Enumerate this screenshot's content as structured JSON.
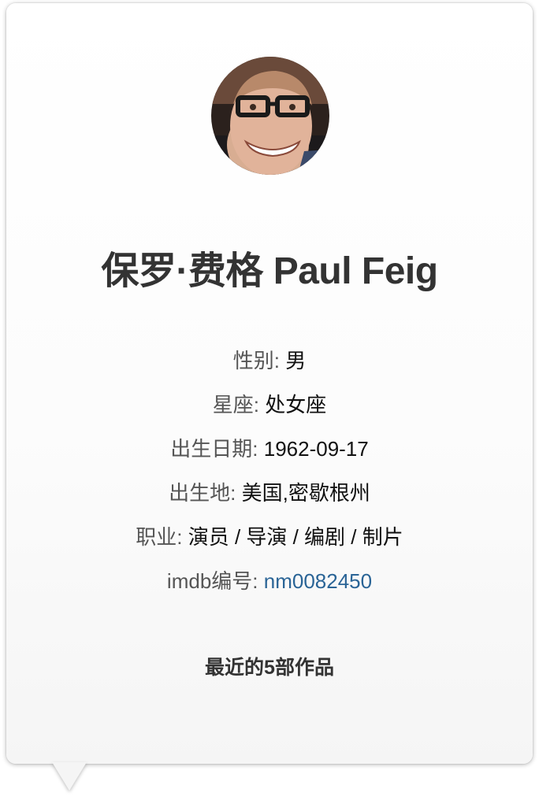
{
  "person": {
    "name": "保罗·费格 Paul Feig",
    "avatar_alt": "保罗·费格 Paul Feig"
  },
  "info": [
    {
      "label": "性别",
      "sep": ": ",
      "value": "男"
    },
    {
      "label": "星座",
      "sep": ": ",
      "value": "处女座"
    },
    {
      "label": "出生日期",
      "sep": ": ",
      "value": "1962-09-17"
    },
    {
      "label": "出生地",
      "sep": ": ",
      "value": "美国,密歇根州"
    },
    {
      "label": "职业",
      "sep": ": ",
      "value": "演员 / 导演 / 编剧 / 制片"
    },
    {
      "label": "imdb编号",
      "sep": ": ",
      "value": "nm0082450"
    }
  ],
  "recent_works_heading": "最近的5部作品",
  "colors": {
    "title": "#333333",
    "label": "#555555",
    "link": "#2a6496"
  }
}
